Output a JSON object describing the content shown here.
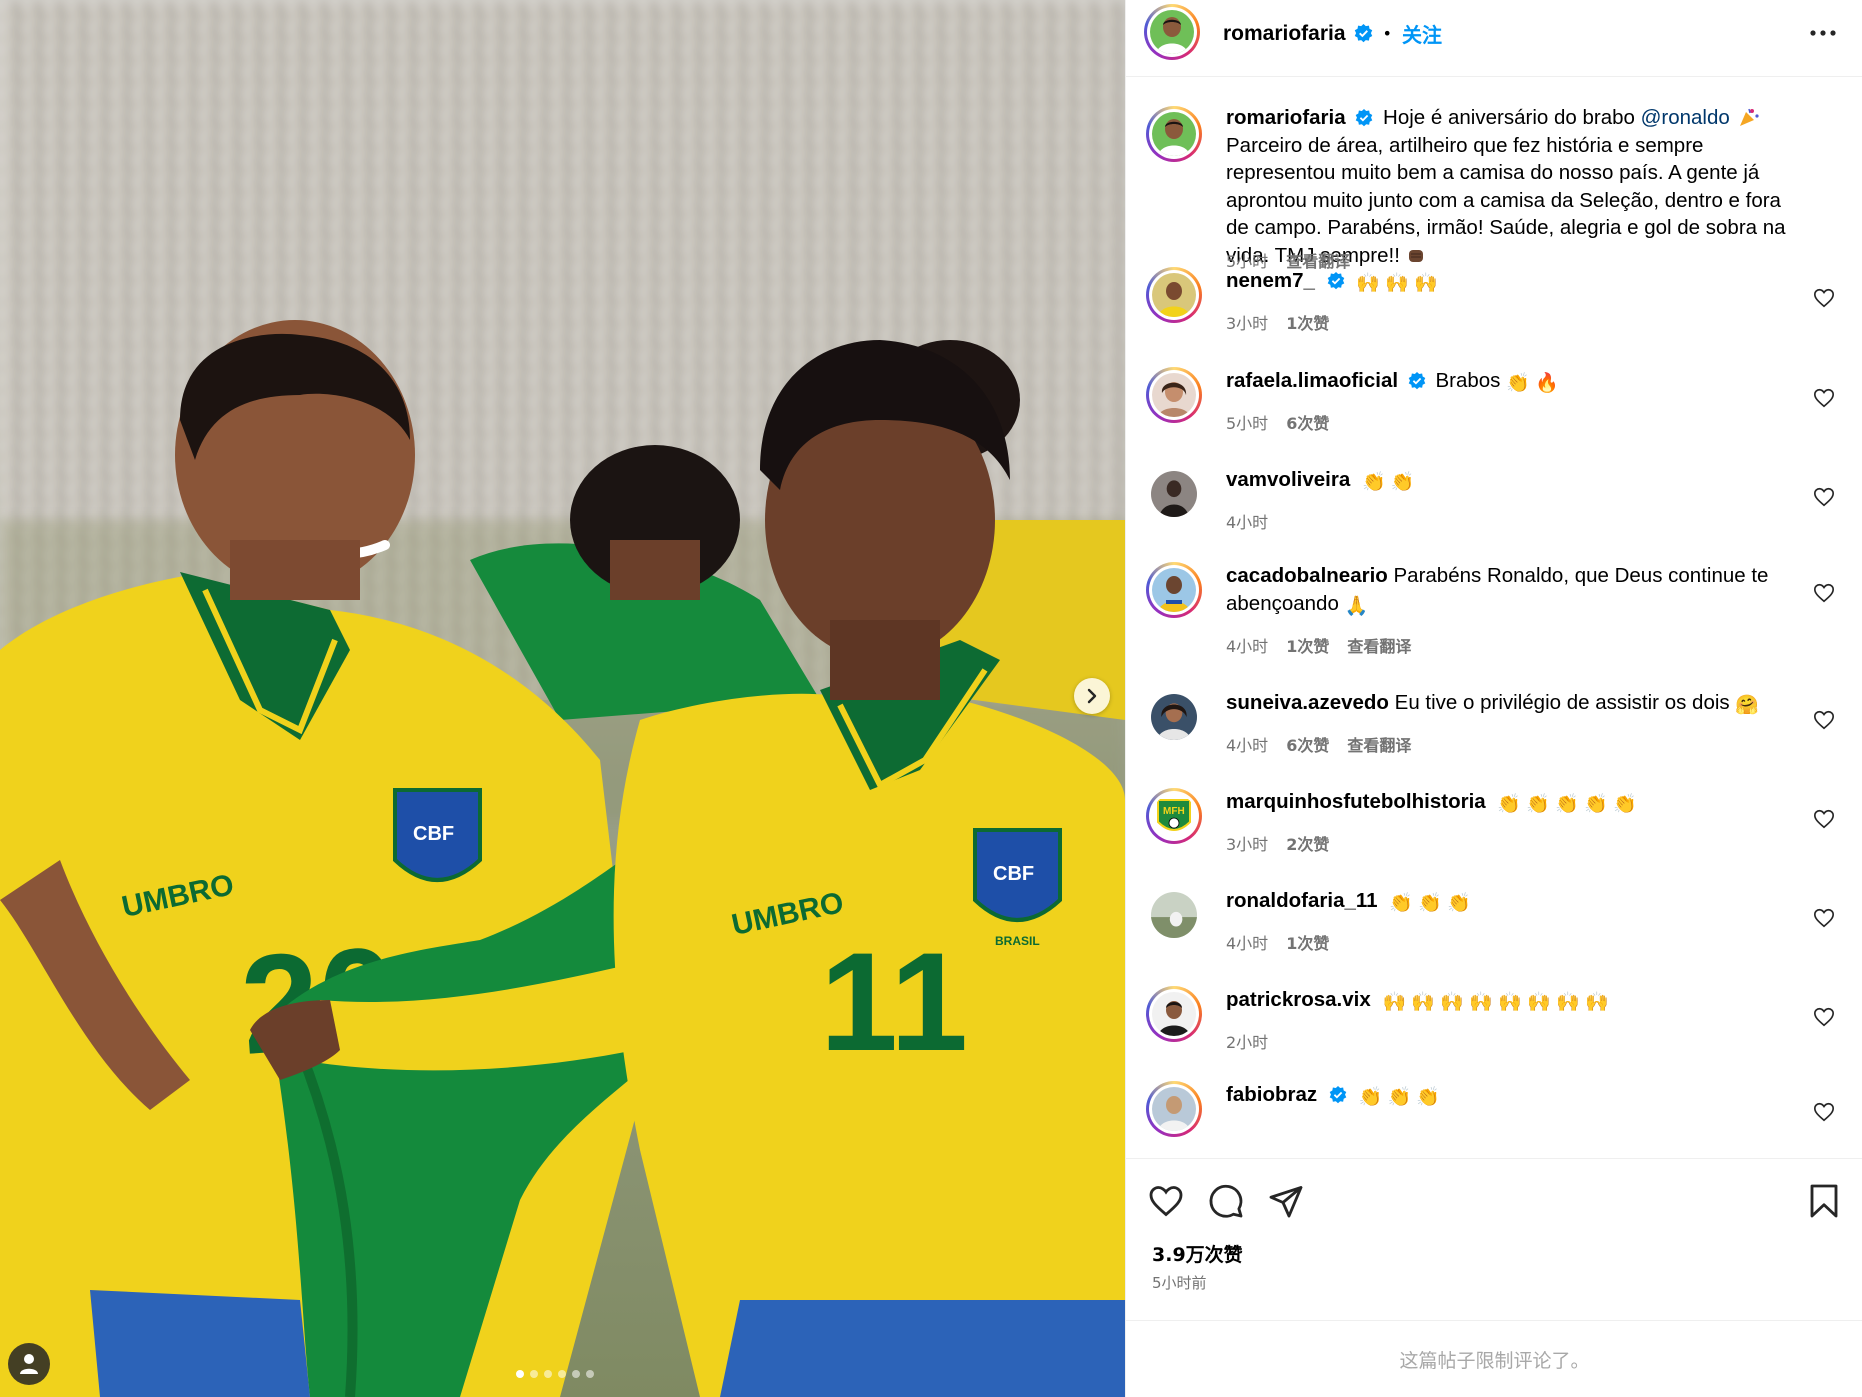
{
  "header": {
    "username": "romariofaria",
    "separator": "•",
    "follow_label": "关注"
  },
  "caption": {
    "username": "romariofaria",
    "text_before": "Hoje é aniversário do brabo ",
    "mention": "@ronaldo",
    "text_after": " Parceiro de área, artilheiro que fez história e sempre representou muito bem a camisa do nosso país. A gente já aprontou muito junto com a camisa da Seleção, dentro e fora de campo. Parabéns, irmão! Saúde, alegria e gol de sobra na vida. TMJ sempre!! ",
    "time": "5小时",
    "translate": "查看翻译"
  },
  "comments": [
    {
      "username": "nenem7_",
      "verified": true,
      "text": "",
      "emoji": "🙌 🙌 🙌",
      "time": "3小时",
      "likes": "1次赞",
      "translate": ""
    },
    {
      "username": "rafaela.limaoficial",
      "verified": true,
      "text": "Brabos",
      "emoji": "👏 🔥",
      "time": "5小时",
      "likes": "6次赞",
      "translate": ""
    },
    {
      "username": "vamvoliveira",
      "verified": false,
      "text": "",
      "emoji": "👏 👏",
      "time": "4小时",
      "likes": "",
      "translate": ""
    },
    {
      "username": "cacadobalneario",
      "verified": false,
      "text": "Parabéns Ronaldo, que Deus continue te abençoando",
      "emoji": "🙏",
      "time": "4小时",
      "likes": "1次赞",
      "translate": "查看翻译"
    },
    {
      "username": "suneiva.azevedo",
      "verified": false,
      "text": "Eu tive o privilégio de assistir os dois",
      "emoji": "🤗",
      "time": "4小时",
      "likes": "6次赞",
      "translate": "查看翻译"
    },
    {
      "username": "marquinhosfutebolhistoria",
      "verified": false,
      "text": "",
      "emoji": "👏 👏 👏 👏 👏",
      "time": "3小时",
      "likes": "2次赞",
      "translate": ""
    },
    {
      "username": "ronaldofaria_11",
      "verified": false,
      "text": "",
      "emoji": "👏 👏 👏",
      "time": "4小时",
      "likes": "1次赞",
      "translate": ""
    },
    {
      "username": "patrickrosa.vix",
      "verified": false,
      "text": "",
      "emoji": "🙌 🙌 🙌 🙌 🙌 🙌 🙌 🙌",
      "time": "2小时",
      "likes": "",
      "translate": ""
    },
    {
      "username": "fabiobraz",
      "verified": true,
      "text": "",
      "emoji": "👏 👏 👏",
      "time": "",
      "likes": "",
      "translate": ""
    }
  ],
  "stats": {
    "likes": "3.9万次赞",
    "posted": "5小时前"
  },
  "footer": {
    "comments_limited": "这篇帖子限制评论了。"
  },
  "media": {
    "jersey_left": "20",
    "jersey_right": "11",
    "brand": "UMBRO",
    "badge": "CBF",
    "badge_sub": "BRASIL",
    "active_dot": 1,
    "dot_count": 6
  },
  "colors": {
    "accent": "#0095f6",
    "jersey_yellow": "#f2d21a",
    "jersey_green": "#0c7a3a",
    "flag_green": "#148a3c",
    "shorts_blue": "#2c63b8",
    "muted": "#737373"
  },
  "icons": {
    "verified": "verified-badge-icon",
    "more": "more-horizontal-icon",
    "like": "heart-icon",
    "comment": "comment-icon",
    "share": "send-icon",
    "save": "bookmark-icon",
    "next": "chevron-right-icon",
    "user": "user-icon"
  }
}
